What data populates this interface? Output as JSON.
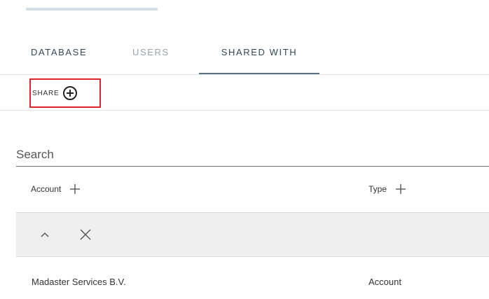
{
  "tabs": [
    {
      "label": "DATABASE",
      "active": false
    },
    {
      "label": "USERS",
      "active": false
    },
    {
      "label": "SHARED WITH",
      "active": true
    }
  ],
  "share": {
    "label": "SHARE",
    "icon": "plus-circle-icon"
  },
  "search": {
    "placeholder": "Search"
  },
  "table": {
    "columns": [
      {
        "label": "Account",
        "icon": "plus-icon"
      },
      {
        "label": "Type",
        "icon": "plus-icon"
      }
    ],
    "filter_row": {
      "icons": [
        "chevron-up-icon",
        "close-icon"
      ]
    },
    "rows": [
      {
        "account": "Madaster Services B.V.",
        "type": "Account"
      }
    ]
  },
  "colors": {
    "active_tab": "#2f4858",
    "inactive_tab": "#9aa3a9",
    "highlight_border": "#e0242a",
    "filter_row_bg": "#efefef"
  }
}
